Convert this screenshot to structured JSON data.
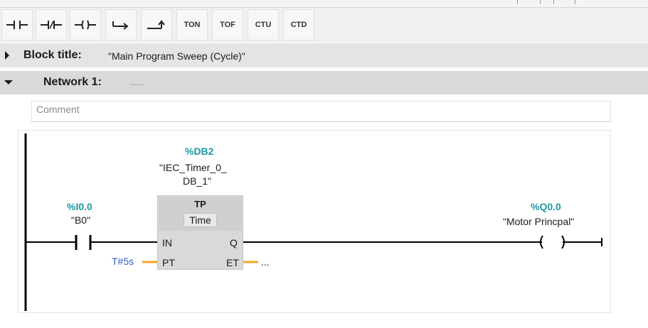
{
  "toolbar": {
    "instructions": [
      {
        "id": "no-contact",
        "label": ""
      },
      {
        "id": "nc-contact",
        "label": ""
      },
      {
        "id": "coil",
        "label": ""
      },
      {
        "id": "branch-open",
        "label": ""
      },
      {
        "id": "branch-close",
        "label": ""
      },
      {
        "id": "ton",
        "label": "TON"
      },
      {
        "id": "tof",
        "label": "TOF"
      },
      {
        "id": "ctu",
        "label": "CTU"
      },
      {
        "id": "ctd",
        "label": "CTD"
      }
    ]
  },
  "block": {
    "label": "Block title:",
    "value": "\"Main Program Sweep (Cycle)\""
  },
  "network": {
    "label": "Network 1:",
    "title_placeholder": ".....",
    "comment_placeholder": "Comment"
  },
  "ladder": {
    "contact": {
      "address": "%I0.0",
      "tag": "\"B0\""
    },
    "timer": {
      "db_address": "%DB2",
      "db_name_line1": "\"IEC_Timer_0_",
      "db_name_line2": "DB_1\"",
      "type": "TP",
      "data_type": "Time",
      "pin_in": "IN",
      "pin_q": "Q",
      "pin_pt": "PT",
      "pin_et": "ET",
      "pt_value": "T#5s",
      "et_value": "..."
    },
    "coil": {
      "address": "%Q0.0",
      "tag": "\"Motor Princpal\""
    }
  },
  "colors": {
    "address": "#1e9aa0",
    "constant": "#3060c0",
    "param_wire": "#f5a623",
    "rail": "#000000"
  }
}
